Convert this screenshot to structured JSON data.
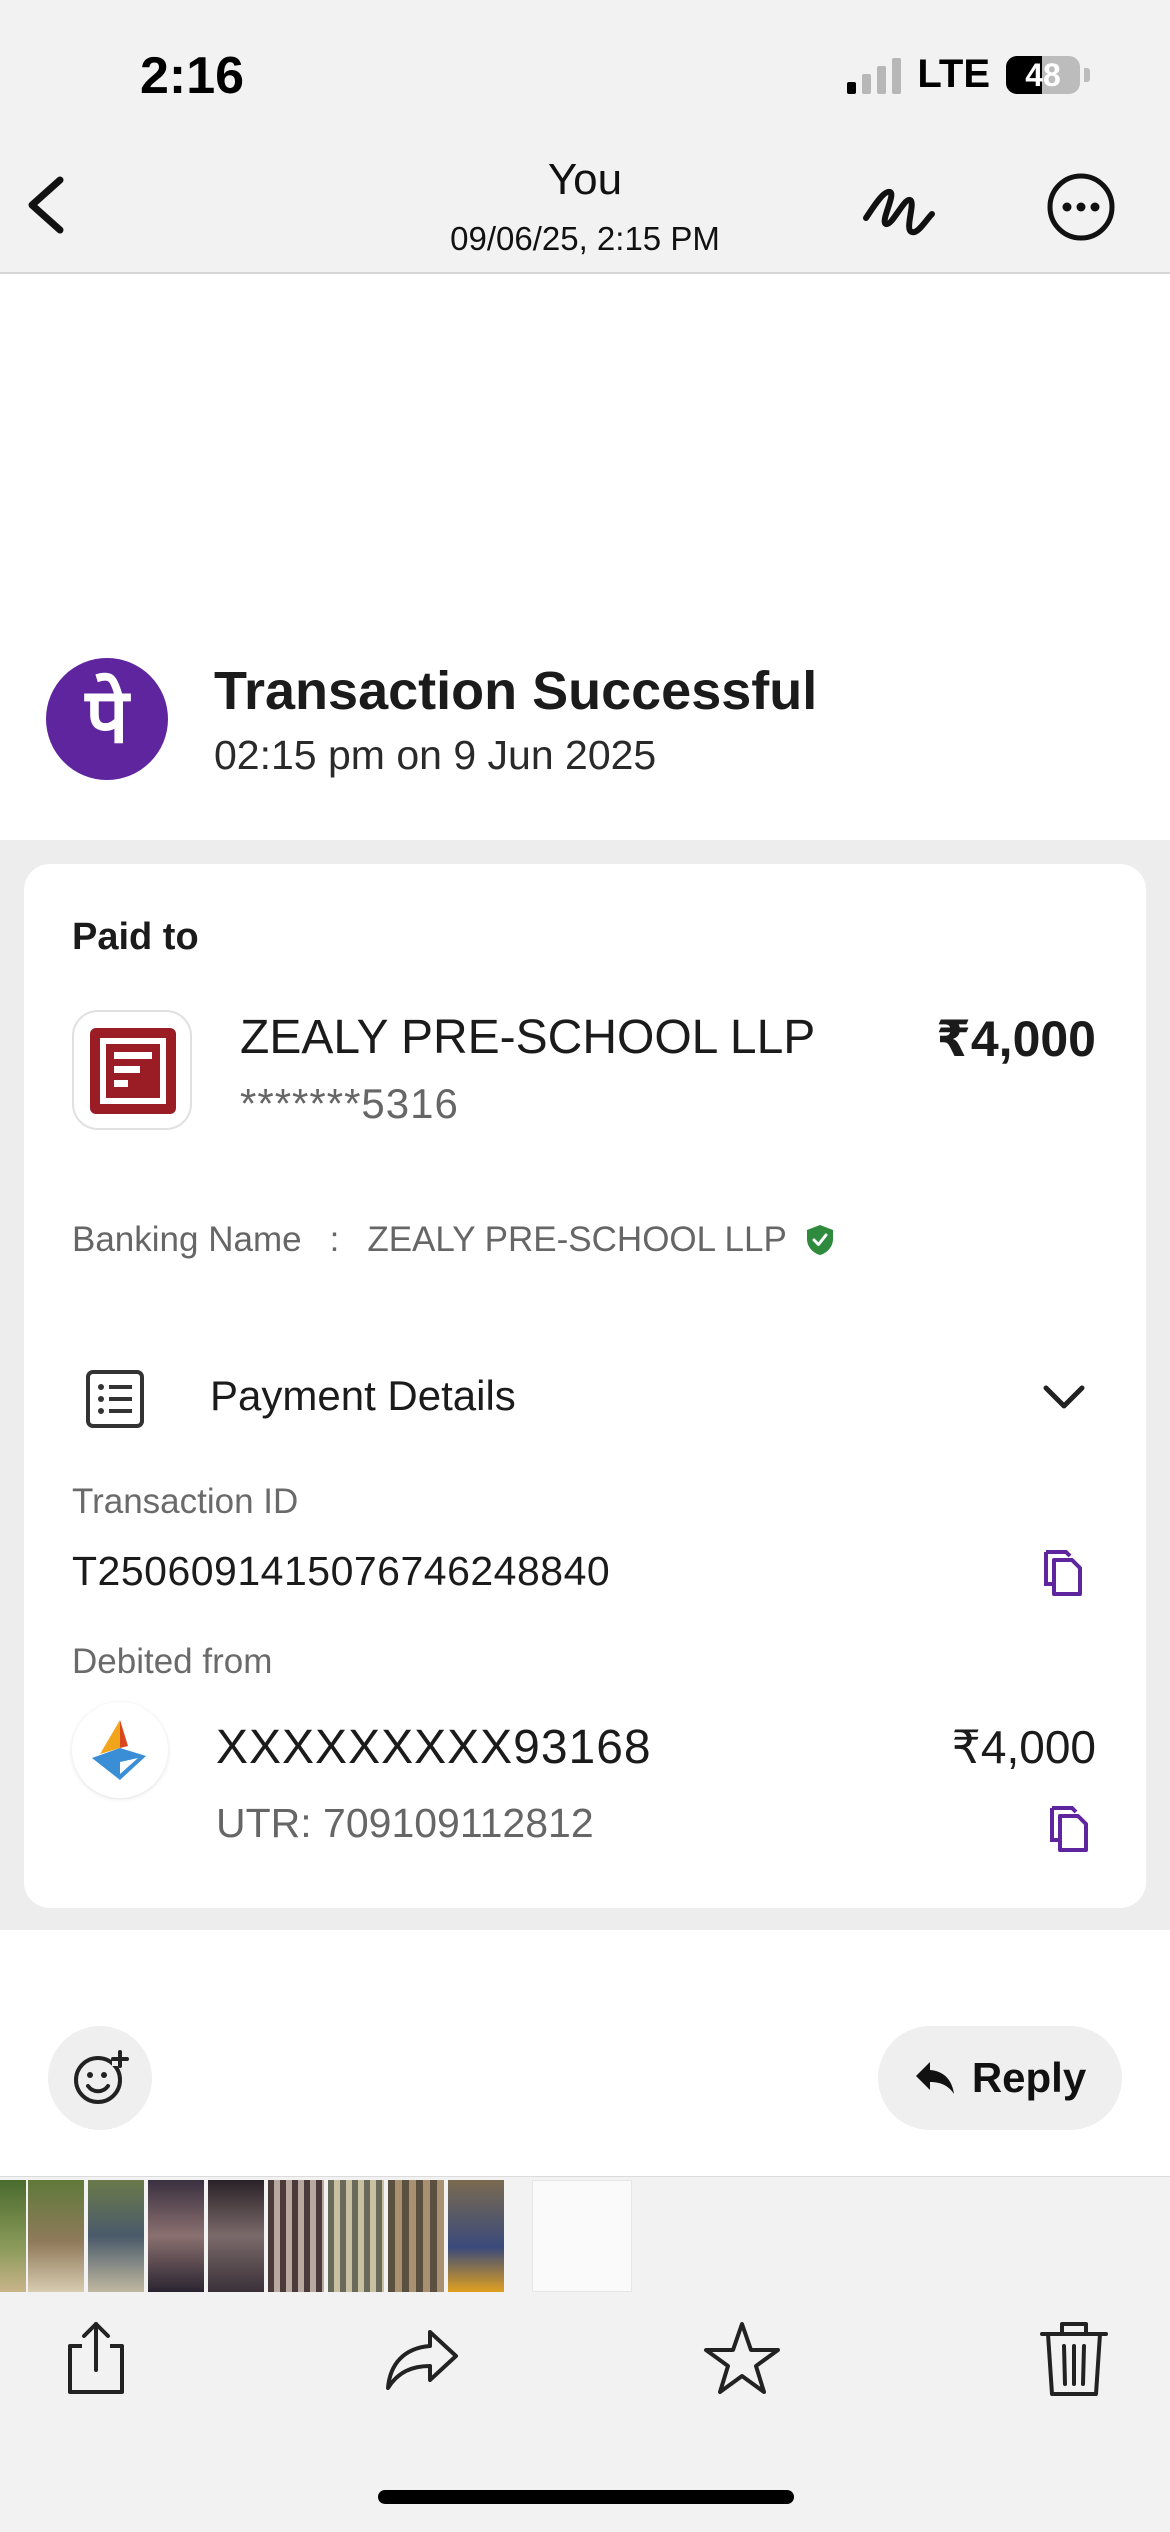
{
  "status_bar": {
    "time": "2:16",
    "network": "LTE",
    "battery": "48"
  },
  "nav": {
    "title": "You",
    "subtitle": "09/06/25, 2:15 PM",
    "icons": [
      "back-chevron-icon",
      "markup-pen-icon",
      "more-options-icon"
    ]
  },
  "receipt": {
    "status_title": "Transaction Successful",
    "status_time": "02:15 pm on 9 Jun 2025",
    "logo_glyph": "पे",
    "paid_to_label": "Paid to",
    "merchant_name": "ZEALY PRE-SCHOOL LLP",
    "merchant_account": "*******5316",
    "amount": "₹4,000",
    "banking_name_label": "Banking Name",
    "banking_name_sep": ":",
    "banking_name_value": "ZEALY PRE-SCHOOL LLP",
    "payment_details_label": "Payment Details",
    "transaction_id_label": "Transaction ID",
    "transaction_id": "T2506091415076746248840",
    "debited_from_label": "Debited from",
    "debit_account": "XXXXXXXXX93168",
    "debit_amount": "₹4,000",
    "utr": "UTR: 709109112812"
  },
  "actions": {
    "reply_label": "Reply"
  },
  "thumbnails": [
    "photo-1",
    "photo-2",
    "photo-3",
    "photo-4",
    "photo-5",
    "photo-6",
    "photo-7",
    "photo-8",
    "photo-9",
    "receipt-screenshot"
  ],
  "toolbar": [
    "share-icon",
    "forward-icon",
    "star-icon",
    "trash-icon"
  ],
  "colors": {
    "phonepe_purple": "#5f259f",
    "merchant_red": "#9a1c25",
    "verified_green": "#2e8b3d"
  }
}
